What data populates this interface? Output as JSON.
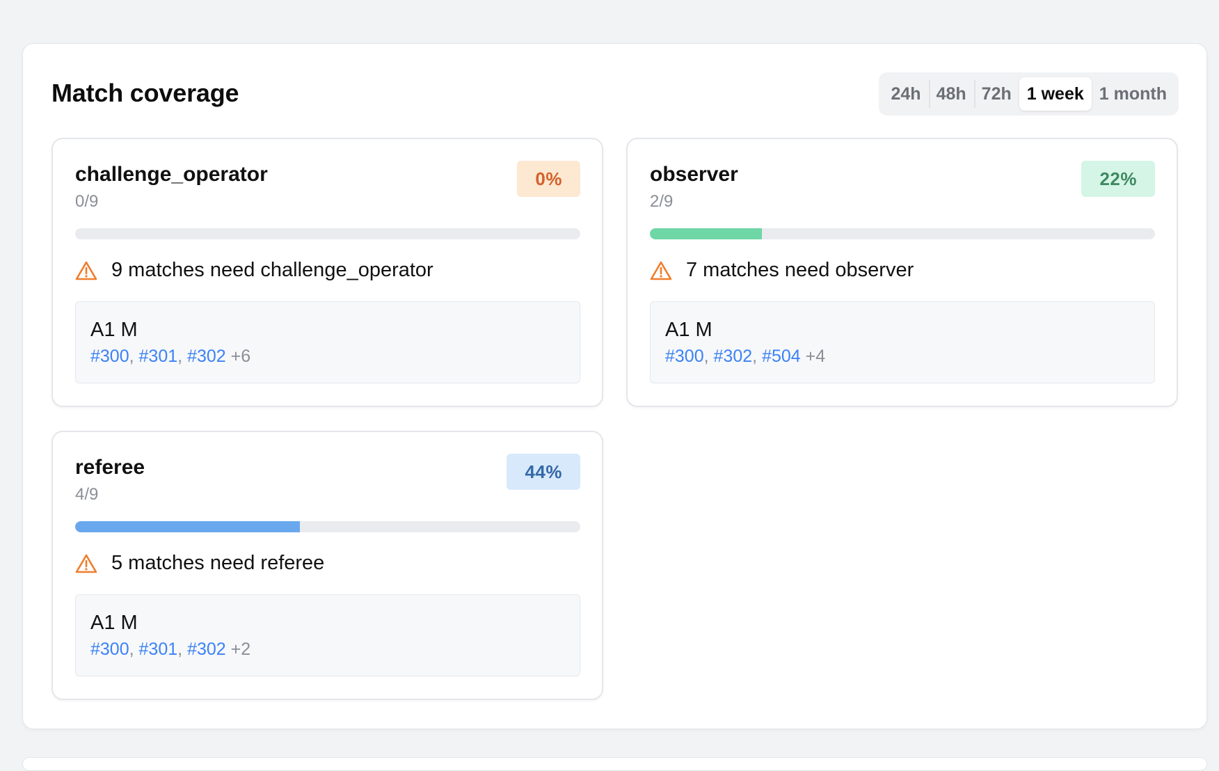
{
  "panel": {
    "title": "Match coverage"
  },
  "range": {
    "options": [
      "24h",
      "48h",
      "72h",
      "1 week",
      "1 month"
    ],
    "selected": "1 week"
  },
  "cards": [
    {
      "role": "challenge_operator",
      "count": "0/9",
      "percent_label": "0%",
      "fraction": 0.0,
      "badge_bg": "#fde8d2",
      "badge_color": "#d3612a",
      "bar_color": "#f4a261",
      "warning": "9 matches need challenge_operator",
      "group": "A1 M",
      "ids": [
        "#300",
        "#301",
        "#302"
      ],
      "more": "+6"
    },
    {
      "role": "observer",
      "count": "2/9",
      "percent_label": "22%",
      "fraction": 0.2222,
      "badge_bg": "#d5f5e6",
      "badge_color": "#3f8a63",
      "bar_color": "#6fd6a6",
      "warning": "7 matches need observer",
      "group": "A1 M",
      "ids": [
        "#300",
        "#302",
        "#504"
      ],
      "more": "+4"
    },
    {
      "role": "referee",
      "count": "4/9",
      "percent_label": "44%",
      "fraction": 0.4444,
      "badge_bg": "#d8e9fb",
      "badge_color": "#3569a8",
      "bar_color": "#6aa8ee",
      "warning": "5 matches need referee",
      "group": "A1 M",
      "ids": [
        "#300",
        "#301",
        "#302"
      ],
      "more": "+2"
    }
  ],
  "colors": {
    "warning_icon": "#ef7d2c",
    "link": "#3b82f6"
  },
  "icons": {
    "warning": "warning-triangle-icon"
  }
}
